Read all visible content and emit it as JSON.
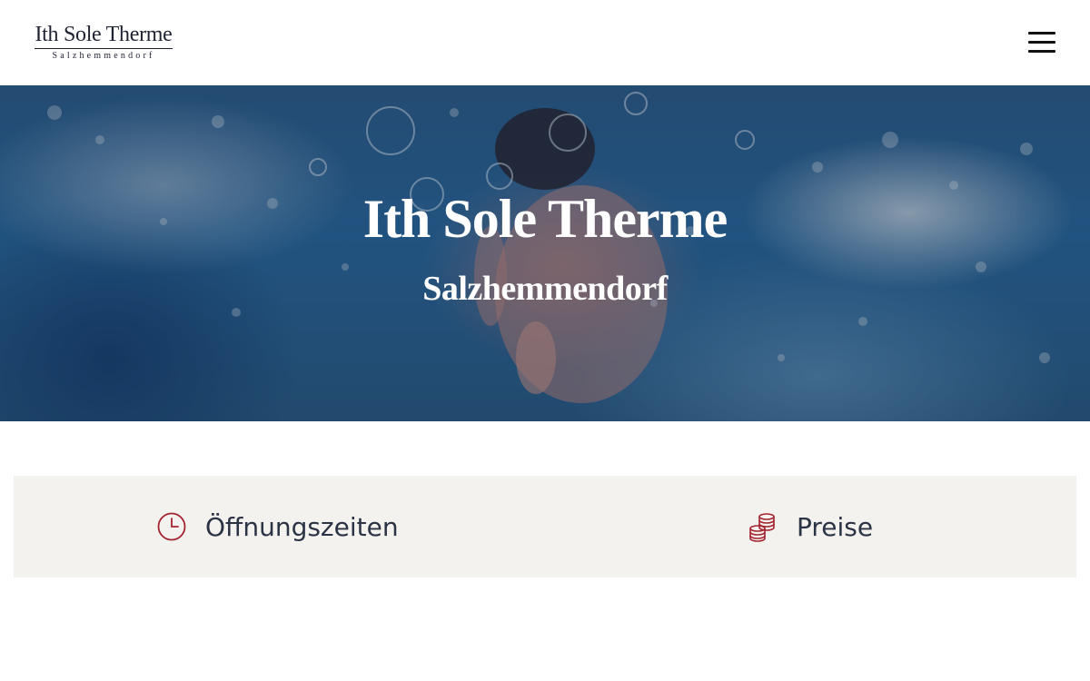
{
  "header": {
    "logo": {
      "title": "Ith Sole Therme",
      "subtitle": "Salzhemmendorf"
    },
    "menu_icon": "hamburger-menu-icon"
  },
  "hero": {
    "title": "Ith Sole Therme",
    "subtitle": "Salzhemmendorf",
    "image": "underwater-swimmer-photo"
  },
  "info_bar": {
    "items": [
      {
        "label": "Öffnungszeiten",
        "icon": "clock-icon"
      },
      {
        "label": "Preise",
        "icon": "coins-icon"
      }
    ]
  },
  "colors": {
    "accent": "#a3232f",
    "text": "#2b3346",
    "info_bar_bg": "#f4f2ee",
    "header_bg": "#ffffff"
  }
}
